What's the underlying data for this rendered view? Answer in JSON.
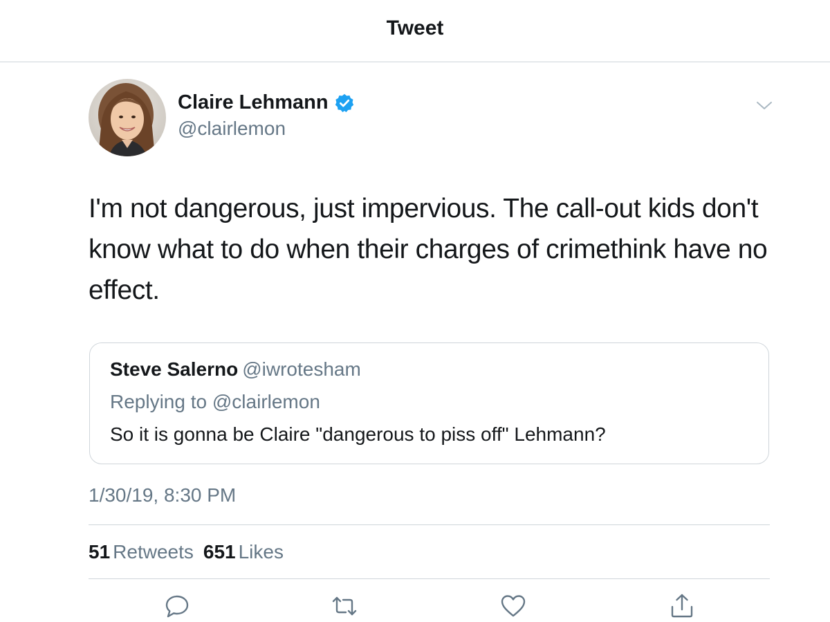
{
  "header": {
    "title": "Tweet"
  },
  "tweet": {
    "author_name": "Claire Lehmann",
    "author_handle": "@clairlemon",
    "verified": true,
    "text": "I'm not dangerous, just impervious. The call-out kids don't know what to do when their charges of crimethink have no effect.",
    "timestamp": "1/30/19, 8:30 PM",
    "retweets_count": "51",
    "retweets_label": "Retweets",
    "likes_count": "651",
    "likes_label": "Likes"
  },
  "quoted_tweet": {
    "author_name": "Steve Salerno",
    "author_handle": "@iwrotesham",
    "replying_prefix": "Replying to",
    "replying_handle": "@clairlemon",
    "text": "So it is gonna be Claire \"dangerous to piss off\" Lehmann?"
  },
  "actions": [
    {
      "name": "reply",
      "icon": "reply-icon"
    },
    {
      "name": "retweet",
      "icon": "retweet-icon"
    },
    {
      "name": "like",
      "icon": "heart-icon"
    },
    {
      "name": "share",
      "icon": "share-icon"
    }
  ],
  "colors": {
    "text_primary": "#14171a",
    "text_secondary": "#657786",
    "verified_blue": "#1da1f2",
    "divider": "#cfd5da",
    "icon_gray": "#657786"
  }
}
